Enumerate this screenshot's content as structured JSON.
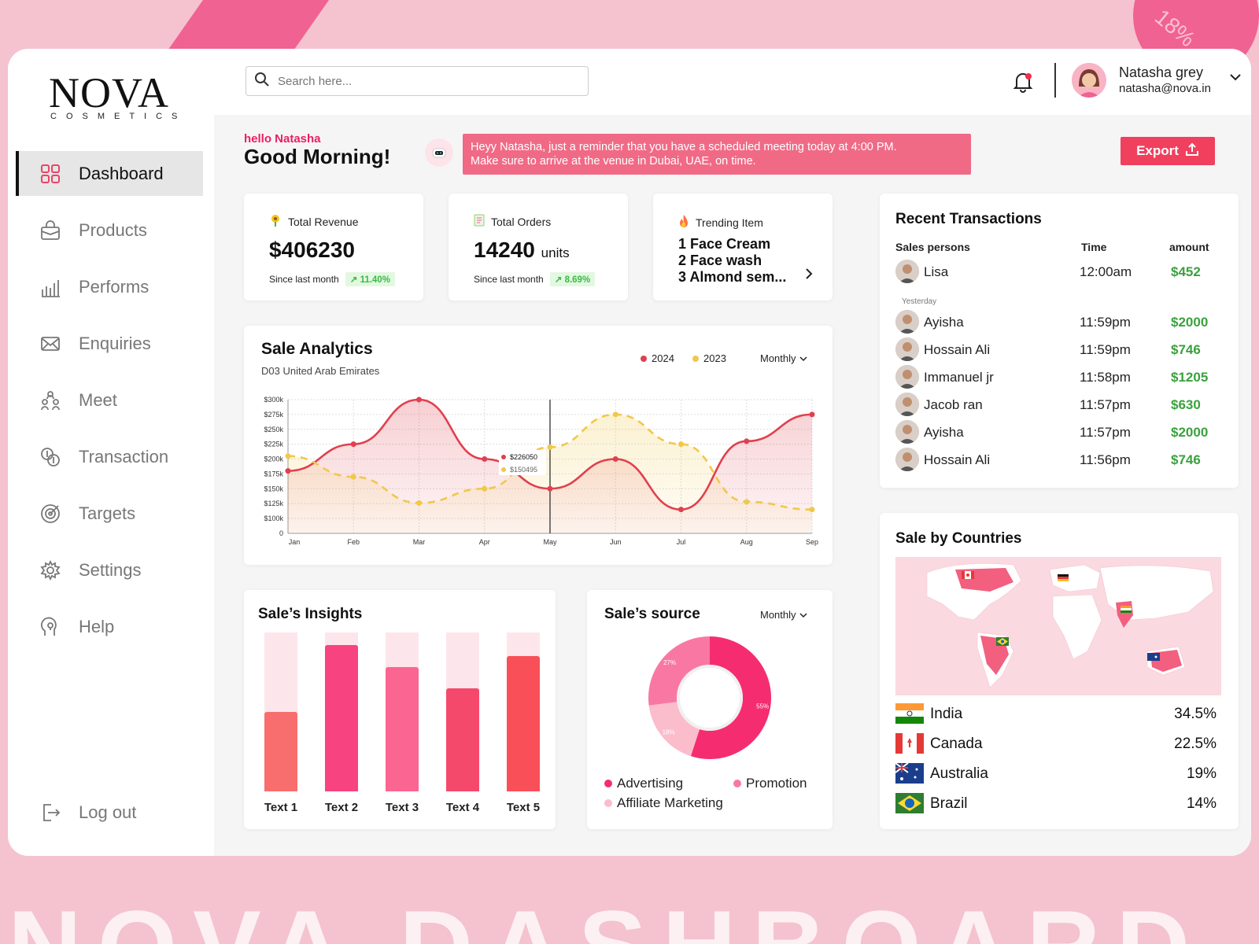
{
  "background": {
    "corner_text": "18%",
    "watermark": "NOVA DASHBOARD"
  },
  "brand": {
    "name": "NOVA",
    "tagline": "COSMETICS",
    "accent": "#e91e63"
  },
  "search": {
    "placeholder": "Search here..."
  },
  "user": {
    "name": "Natasha grey",
    "email": "natasha@nova.in"
  },
  "sidebar": {
    "items": [
      {
        "label": "Dashboard",
        "icon": "grid-icon",
        "active": true
      },
      {
        "label": "Products",
        "icon": "bag-icon"
      },
      {
        "label": "Performs",
        "icon": "bar-chart-icon"
      },
      {
        "label": "Enquiries",
        "icon": "mail-icon"
      },
      {
        "label": "Meet",
        "icon": "meeting-icon"
      },
      {
        "label": "Transaction",
        "icon": "coins-icon"
      },
      {
        "label": "Targets",
        "icon": "target-icon"
      },
      {
        "label": "Settings",
        "icon": "gear-icon"
      },
      {
        "label": "Help",
        "icon": "help-icon"
      }
    ],
    "logout": "Log out"
  },
  "greeting": {
    "small": "hello Natasha",
    "big": "Good Morning!"
  },
  "reminder": {
    "line1": "Heyy Natasha, just a reminder that you have a scheduled meeting today at 4:00 PM.",
    "line2": "Make sure to arrive at the venue in Dubai, UAE, on time."
  },
  "export_label": "Export",
  "kpis": {
    "revenue": {
      "title": "Total Revenue",
      "value": "$406230",
      "since": "Since last month",
      "change": "11.40%"
    },
    "orders": {
      "title": "Total Orders",
      "value": "14240",
      "unit": "units",
      "since": "Since last month",
      "change": "8.69%"
    },
    "trending": {
      "title": "Trending Item",
      "items": [
        "1 Face Cream",
        "2 Face wash",
        "3 Almond sem..."
      ]
    }
  },
  "sale_analytics": {
    "title": "Sale Analytics",
    "subtitle": "D03 United Arab Emirates",
    "period": "Monthly",
    "tooltip": {
      "v2024": "$226050",
      "v2023": "$150495"
    }
  },
  "chart_data": [
    {
      "type": "line",
      "title": "Sale Analytics",
      "categories": [
        "Jan",
        "Feb",
        "Mar",
        "Apr",
        "May",
        "Jun",
        "Jul",
        "Aug",
        "Sep"
      ],
      "y_ticks": [
        "0",
        "$100k",
        "$125k",
        "$150k",
        "$175k",
        "$200k",
        "$225k",
        "$250k",
        "$275k",
        "$300k"
      ],
      "ylim": [
        0,
        300000
      ],
      "series": [
        {
          "name": "2024",
          "color": "#e0404e",
          "values": [
            180000,
            225000,
            300000,
            200000,
            150000,
            200000,
            115000,
            230000,
            275000
          ]
        },
        {
          "name": "2023",
          "color": "#f0c84a",
          "values": [
            205000,
            170000,
            126000,
            150000,
            220000,
            275000,
            225000,
            128000,
            115000
          ]
        }
      ],
      "grid": true,
      "legend": "top-right"
    },
    {
      "type": "bar",
      "title": "Sale's Insights",
      "categories": [
        "Text 1",
        "Text 2",
        "Text 3",
        "Text 4",
        "Text 5"
      ],
      "values": [
        0.5,
        0.92,
        0.78,
        0.65,
        0.85
      ],
      "colors": [
        "#f86d6d",
        "#f7437f",
        "#fb6592",
        "#f5496b",
        "#f94f58"
      ]
    },
    {
      "type": "pie",
      "title": "Sale's source",
      "period": "Monthly",
      "slices": [
        {
          "name": "Advertising",
          "value": 55,
          "color": "#f52d70"
        },
        {
          "name": "Affiliate Marketing",
          "value": 18,
          "color": "#fbbccc"
        },
        {
          "name": "Promotion",
          "value": 27,
          "color": "#f978a3"
        }
      ]
    }
  ],
  "transactions": {
    "title": "Recent Transactions",
    "headers": {
      "person": "Sales persons",
      "time": "Time",
      "amount": "amount"
    },
    "yesterday": "Yesterday",
    "rows": [
      {
        "name": "Lisa",
        "time": "12:00am",
        "amount": "$452"
      },
      {
        "name": "Ayisha",
        "time": "11:59pm",
        "amount": "$2000"
      },
      {
        "name": "Hossain Ali",
        "time": "11:59pm",
        "amount": "$746"
      },
      {
        "name": "Immanuel jr",
        "time": "11:58pm",
        "amount": "$1205"
      },
      {
        "name": "Jacob ran",
        "time": "11:57pm",
        "amount": "$630"
      },
      {
        "name": "Ayisha",
        "time": "11:57pm",
        "amount": "$2000"
      },
      {
        "name": "Hossain Ali",
        "time": "11:56pm",
        "amount": "$746"
      }
    ]
  },
  "sale_insights": {
    "title": "Sale’s Insights"
  },
  "sale_source": {
    "title": "Sale’s source",
    "period": "Monthly",
    "slice_labels": [
      "55%",
      "18%",
      "27%"
    ],
    "legend": [
      "Advertising",
      "Promotion",
      "Affiliate Marketing"
    ]
  },
  "countries": {
    "title": "Sale by Countries",
    "rows": [
      {
        "name": "India",
        "value": "34.5%"
      },
      {
        "name": "Canada",
        "value": "22.5%"
      },
      {
        "name": "Australia",
        "value": "19%"
      },
      {
        "name": "Brazil",
        "value": "14%"
      }
    ]
  }
}
